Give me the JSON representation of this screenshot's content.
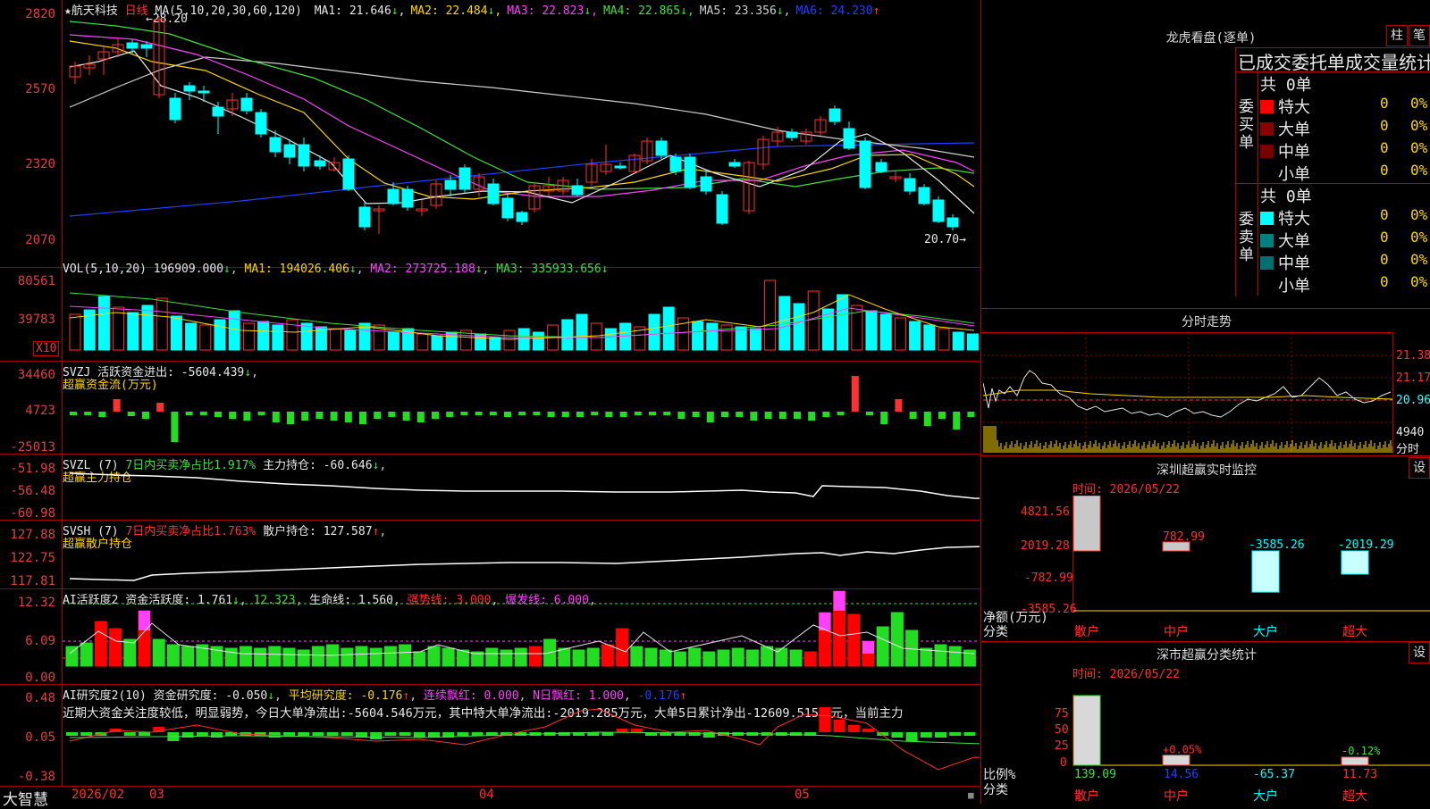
{
  "main_chart": {
    "y_ticks": [
      "2820",
      "2570",
      "2320",
      "2070"
    ],
    "stock_name": "航天科技",
    "period": "日线",
    "high_marker": "←28.20",
    "low_marker": "20.70→",
    "ma_params": "MA(5,10,20,30,60,120)",
    "ma": [
      {
        "label": "MA1: 21.646",
        "arrow": "↓",
        "color": "#e8e8e8"
      },
      {
        "label": "MA2: 22.484",
        "arrow": "↓",
        "color": "#ffd700"
      },
      {
        "label": "MA3: 22.823",
        "arrow": "↓",
        "color": "#ff40ff"
      },
      {
        "label": "MA4: 22.865",
        "arrow": "↓",
        "color": "#40e040"
      },
      {
        "label": "MA5: 23.356",
        "arrow": "↓",
        "color": "#d0d0d0"
      },
      {
        "label": "MA6: 24.230",
        "arrow": "↑",
        "color": "#2040ff"
      }
    ]
  },
  "vol_panel": {
    "y_ticks": [
      "80561",
      "39783"
    ],
    "unit": "X10",
    "title": "VOL(5,10,20)",
    "value": "196909.000",
    "ma1": "MA1: 194026.406",
    "ma2": "MA2: 273725.188",
    "ma3": "MA3: 335933.656"
  },
  "svzj_panel": {
    "y_ticks": [
      "34460",
      "4723",
      "-25013"
    ],
    "line1": "SVZJ  活跃资金进出: -5604.439",
    "line2": "超赢资金流(万元)"
  },
  "svzl_panel": {
    "y_ticks": [
      "-51.98",
      "-56.48",
      "-60.98"
    ],
    "name": "SVZL (7)",
    "ratio": "7日内买卖净占比1.917%",
    "hold": "主力持仓: -60.646",
    "line2": "超赢主力持仓"
  },
  "svsh_panel": {
    "y_ticks": [
      "127.88",
      "122.75",
      "117.81"
    ],
    "name": "SVSH (7)",
    "ratio": "7日内买卖净占比1.763%",
    "hold": "散户持仓: 127.587",
    "line2": "超赢散户持仓"
  },
  "ai_active_panel": {
    "y_ticks": [
      "12.32",
      "6.09",
      "0.00"
    ],
    "name": "AI活跃度2",
    "activity": "资金活跃度: 1.761",
    "v2": "12.323",
    "life": "生命线: 1.560",
    "strong": "强势线: 3.000",
    "burst": "爆发线: 6.000"
  },
  "ai_research_panel": {
    "y_ticks": [
      "0.48",
      "0.05",
      "-0.38"
    ],
    "name": "AI研究度2(10)",
    "research": "资金研究度: -0.050",
    "avg": "平均研究度: -0.176",
    "cont": "连续飘红: 0.000",
    "nday": "N日飘红: 1.000",
    "last": "-0.176",
    "comment": "近期大资金关注度较低，明显弱势，今日大单净流出:-5604.546万元，其中特大单净流出:-2019.285万元，大单5日累计净出-12609.515万元，当前主力"
  },
  "bottom_bar": {
    "logo": "大智慧",
    "dates": [
      "2026/02",
      "03",
      "04",
      "05"
    ]
  },
  "dragon_tiger": {
    "title": "龙虎看盘(逐单)",
    "btn_bar": "柱",
    "btn_pen": "笔",
    "header": "已成交委托单成交量统计",
    "buy_label": "委买单",
    "sell_label": "委卖单",
    "buy_total": "共 0单",
    "sell_total": "共 0单",
    "buy_rows": [
      {
        "name": "特大",
        "count": "0",
        "pct": "0%",
        "color": "#ff0000"
      },
      {
        "name": "大单",
        "count": "0",
        "pct": "0%",
        "color": "#8b0000"
      },
      {
        "name": "中单",
        "count": "0",
        "pct": "0%",
        "color": "#7a0000"
      },
      {
        "name": "小单",
        "count": "0",
        "pct": "0%",
        "color": ""
      }
    ],
    "sell_rows": [
      {
        "name": "特大",
        "count": "0",
        "pct": "0%",
        "color": "#00ffff"
      },
      {
        "name": "大单",
        "count": "0",
        "pct": "0%",
        "color": "#008080"
      },
      {
        "name": "中单",
        "count": "0",
        "pct": "0%",
        "color": "#006f6f"
      },
      {
        "name": "小单",
        "count": "0",
        "pct": "0%",
        "color": ""
      }
    ]
  },
  "intraday": {
    "title": "分时走势",
    "y_ticks": [
      "21.38",
      "21.17",
      "20.96"
    ],
    "vol_tick": "4940",
    "label": "分时"
  },
  "realtime_monitor": {
    "title": "深圳超赢实时监控",
    "settings": "设",
    "time": "时间: 2026/05/22",
    "y_ticks": [
      "4821.56",
      "2019.28",
      "-782.99",
      "-3585.26"
    ],
    "ylabel1": "净额(万元)",
    "ylabel2": "分类",
    "bars": [
      {
        "cat": "散户",
        "value": "4821.56",
        "num": 4821.56
      },
      {
        "cat": "中户",
        "value": "782.99",
        "num": 782.99
      },
      {
        "cat": "大户",
        "value": "-3585.26",
        "num": -3585.26
      },
      {
        "cat": "超大",
        "value": "-2019.29",
        "num": -2019.29
      }
    ]
  },
  "class_stats": {
    "title": "深市超赢分类统计",
    "settings": "设",
    "time": "时间: 2026/05/22",
    "y_ticks": [
      "75",
      "50",
      "25",
      "0"
    ],
    "ylabel1": "比例%",
    "ylabel2": "分类",
    "bars": [
      {
        "cat": "散户",
        "value": "139.09",
        "change": "",
        "num": 139.09
      },
      {
        "cat": "中户",
        "value": "14.56",
        "change": "+0.05%",
        "num": 14.56
      },
      {
        "cat": "大户",
        "value": "-65.37",
        "change": "",
        "num": -65.37
      },
      {
        "cat": "超大",
        "value": "11.73",
        "change": "-0.12%",
        "num": 11.73
      }
    ]
  }
}
